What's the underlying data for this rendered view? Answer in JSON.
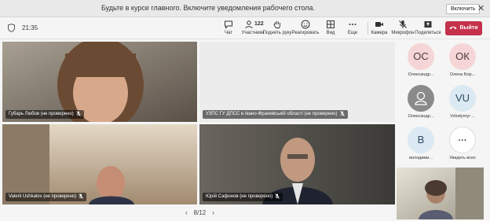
{
  "notification": {
    "text": "Будьте в курсе главного. Включите уведомления рабочего стола.",
    "enable_label": "Включить",
    "close_glyph": "✕"
  },
  "meeting": {
    "time": "21:35"
  },
  "toolbar": {
    "chat": "Чат",
    "participants": "Участники",
    "participants_count": "122",
    "raise_hand": "Поднять руку",
    "react": "Реагировать",
    "view": "Вид",
    "more": "Еще",
    "camera": "Камера",
    "mic": "Микрофон",
    "share": "Поделиться",
    "leave": "Выйти"
  },
  "videos": [
    {
      "name": "Губарь Любов (не проверено)"
    },
    {
      "name": "УЗПС ГУ ДПСС в Івано-Франківській області (не проверено)"
    },
    {
      "name": "Valerii Ushkalov (не проверено)"
    },
    {
      "name": "Юрій Сафонов (не проверено)"
    }
  ],
  "pager": {
    "prev": "‹",
    "label": "8/12",
    "next": "›"
  },
  "roster": [
    {
      "initials": "ОС",
      "name": "Олександр...",
      "color": "#f5d5d5"
    },
    {
      "initials": "ОК",
      "name": "Олена Бор...",
      "color": "#f5d5d5"
    },
    {
      "initials": "",
      "name": "Олександр...",
      "color": "#8a8a8a"
    },
    {
      "initials": "VU",
      "name": "Volodymyr ...",
      "color": "#dbe9f2"
    },
    {
      "initials": "В",
      "name": "володими...",
      "color": "#dbe9f2"
    },
    {
      "initials": "···",
      "name": "Увидеть всех",
      "color": "#ffffff"
    }
  ],
  "colors": {
    "leave": "#c4314b",
    "toolbar": "#f5f5f5",
    "notification": "#e9e9e9"
  }
}
